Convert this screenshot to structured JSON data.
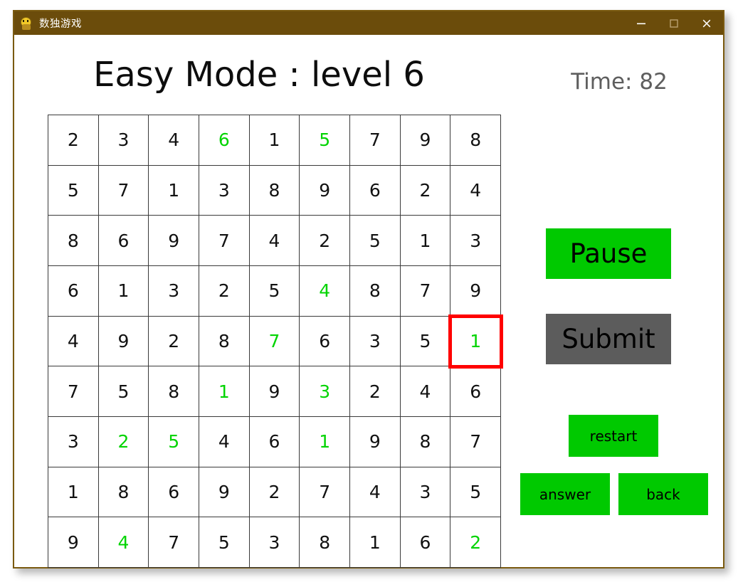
{
  "window": {
    "title": "数独游戏",
    "icon": "app-character-icon",
    "border_color": "#7a5a10",
    "titlebar_color": "#6b4c0b",
    "controls": {
      "minimize": "minimize-icon",
      "maximize": "maximize-icon",
      "close": "close-icon"
    }
  },
  "header": {
    "title": "Easy Mode : level 6",
    "timer_label": "Time: 82",
    "timer_color": "#5e5e5e"
  },
  "colors": {
    "given_number": "#111111",
    "user_number": "#00d400",
    "selection_border": "#ff0000",
    "button_green": "#00c900",
    "button_gray": "#5c5c5c",
    "grid_line": "#3a3a3a"
  },
  "board": {
    "size": 9,
    "selected_cell": {
      "row": 4,
      "col": 8
    },
    "rows": [
      [
        {
          "value": "2",
          "kind": "given"
        },
        {
          "value": "3",
          "kind": "given"
        },
        {
          "value": "4",
          "kind": "given"
        },
        {
          "value": "6",
          "kind": "user"
        },
        {
          "value": "1",
          "kind": "given"
        },
        {
          "value": "5",
          "kind": "user"
        },
        {
          "value": "7",
          "kind": "given"
        },
        {
          "value": "9",
          "kind": "given"
        },
        {
          "value": "8",
          "kind": "given"
        }
      ],
      [
        {
          "value": "5",
          "kind": "given"
        },
        {
          "value": "7",
          "kind": "given"
        },
        {
          "value": "1",
          "kind": "given"
        },
        {
          "value": "3",
          "kind": "given"
        },
        {
          "value": "8",
          "kind": "given"
        },
        {
          "value": "9",
          "kind": "given"
        },
        {
          "value": "6",
          "kind": "given"
        },
        {
          "value": "2",
          "kind": "given"
        },
        {
          "value": "4",
          "kind": "given"
        }
      ],
      [
        {
          "value": "8",
          "kind": "given"
        },
        {
          "value": "6",
          "kind": "given"
        },
        {
          "value": "9",
          "kind": "given"
        },
        {
          "value": "7",
          "kind": "given"
        },
        {
          "value": "4",
          "kind": "given"
        },
        {
          "value": "2",
          "kind": "given"
        },
        {
          "value": "5",
          "kind": "given"
        },
        {
          "value": "1",
          "kind": "given"
        },
        {
          "value": "3",
          "kind": "given"
        }
      ],
      [
        {
          "value": "6",
          "kind": "given"
        },
        {
          "value": "1",
          "kind": "given"
        },
        {
          "value": "3",
          "kind": "given"
        },
        {
          "value": "2",
          "kind": "given"
        },
        {
          "value": "5",
          "kind": "given"
        },
        {
          "value": "4",
          "kind": "user"
        },
        {
          "value": "8",
          "kind": "given"
        },
        {
          "value": "7",
          "kind": "given"
        },
        {
          "value": "9",
          "kind": "given"
        }
      ],
      [
        {
          "value": "4",
          "kind": "given"
        },
        {
          "value": "9",
          "kind": "given"
        },
        {
          "value": "2",
          "kind": "given"
        },
        {
          "value": "8",
          "kind": "given"
        },
        {
          "value": "7",
          "kind": "user"
        },
        {
          "value": "6",
          "kind": "given"
        },
        {
          "value": "3",
          "kind": "given"
        },
        {
          "value": "5",
          "kind": "given"
        },
        {
          "value": "1",
          "kind": "user"
        }
      ],
      [
        {
          "value": "7",
          "kind": "given"
        },
        {
          "value": "5",
          "kind": "given"
        },
        {
          "value": "8",
          "kind": "given"
        },
        {
          "value": "1",
          "kind": "user"
        },
        {
          "value": "9",
          "kind": "given"
        },
        {
          "value": "3",
          "kind": "user"
        },
        {
          "value": "2",
          "kind": "given"
        },
        {
          "value": "4",
          "kind": "given"
        },
        {
          "value": "6",
          "kind": "given"
        }
      ],
      [
        {
          "value": "3",
          "kind": "given"
        },
        {
          "value": "2",
          "kind": "user"
        },
        {
          "value": "5",
          "kind": "user"
        },
        {
          "value": "4",
          "kind": "given"
        },
        {
          "value": "6",
          "kind": "given"
        },
        {
          "value": "1",
          "kind": "user"
        },
        {
          "value": "9",
          "kind": "given"
        },
        {
          "value": "8",
          "kind": "given"
        },
        {
          "value": "7",
          "kind": "given"
        }
      ],
      [
        {
          "value": "1",
          "kind": "given"
        },
        {
          "value": "8",
          "kind": "given"
        },
        {
          "value": "6",
          "kind": "given"
        },
        {
          "value": "9",
          "kind": "given"
        },
        {
          "value": "2",
          "kind": "given"
        },
        {
          "value": "7",
          "kind": "given"
        },
        {
          "value": "4",
          "kind": "given"
        },
        {
          "value": "3",
          "kind": "given"
        },
        {
          "value": "5",
          "kind": "given"
        }
      ],
      [
        {
          "value": "9",
          "kind": "given"
        },
        {
          "value": "4",
          "kind": "user"
        },
        {
          "value": "7",
          "kind": "given"
        },
        {
          "value": "5",
          "kind": "given"
        },
        {
          "value": "3",
          "kind": "given"
        },
        {
          "value": "8",
          "kind": "given"
        },
        {
          "value": "1",
          "kind": "given"
        },
        {
          "value": "6",
          "kind": "given"
        },
        {
          "value": "2",
          "kind": "user"
        }
      ]
    ]
  },
  "controls": {
    "pause": "Pause",
    "submit": "Submit",
    "restart": "restart",
    "answer": "answer",
    "back": "back"
  }
}
